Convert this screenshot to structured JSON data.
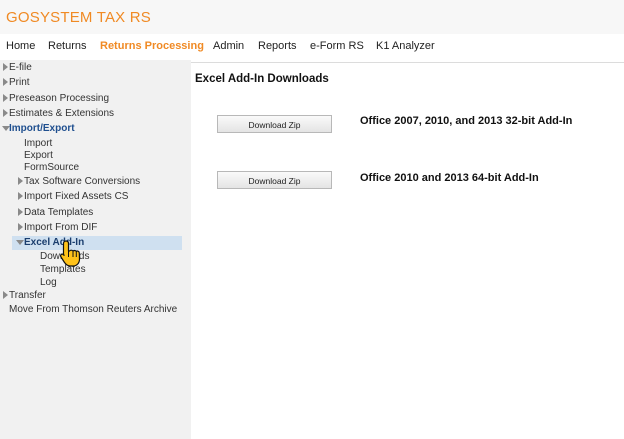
{
  "app": {
    "title": "GOSYSTEM TAX RS"
  },
  "nav": [
    {
      "label": "Home"
    },
    {
      "label": "Returns"
    },
    {
      "label": "Returns Processing"
    },
    {
      "label": "Admin"
    },
    {
      "label": "Reports"
    },
    {
      "label": "e-Form RS"
    },
    {
      "label": "K1 Analyzer"
    }
  ],
  "sidebar": {
    "items": [
      {
        "label": "E-file"
      },
      {
        "label": "Print"
      },
      {
        "label": "Preseason Processing"
      },
      {
        "label": "Estimates & Extensions"
      },
      {
        "label": "Import/Export"
      },
      {
        "label": "Import"
      },
      {
        "label": "Export"
      },
      {
        "label": "FormSource"
      },
      {
        "label": "Tax Software Conversions"
      },
      {
        "label": "Import Fixed Assets CS"
      },
      {
        "label": "Data Templates"
      },
      {
        "label": "Import From DIF"
      },
      {
        "label": "Excel Add-In"
      },
      {
        "label": "Downloads"
      },
      {
        "label": "Templates"
      },
      {
        "label": "Log"
      },
      {
        "label": "Transfer"
      },
      {
        "label": "Move From Thomson Reuters Archive"
      }
    ]
  },
  "main": {
    "title": "Excel Add-In Downloads",
    "downloads": [
      {
        "button": "Download Zip",
        "description": "Office 2007, 2010, and 2013 32-bit Add-In"
      },
      {
        "button": "Download Zip",
        "description": "Office 2010 and 2013 64-bit Add-In"
      }
    ]
  },
  "colors": {
    "accent": "#f08a24",
    "tree_bold": "#1f4f8f",
    "selection": "#cfe0f0"
  },
  "icons": {
    "cursor": "hand-pointer-icon"
  }
}
